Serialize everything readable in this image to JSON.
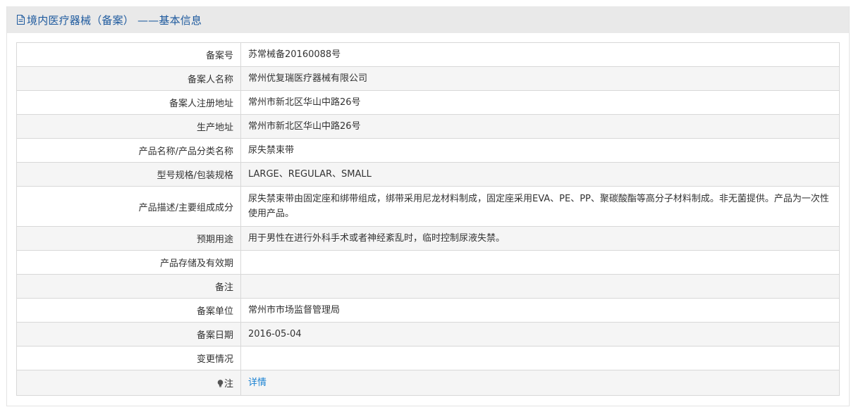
{
  "header": {
    "title": "境内医疗器械（备案） ——基本信息"
  },
  "rows": [
    {
      "label": "备案号",
      "value": "苏常械备20160088号"
    },
    {
      "label": "备案人名称",
      "value": "常州优复瑞医疗器械有限公司"
    },
    {
      "label": "备案人注册地址",
      "value": "常州市新北区华山中路26号"
    },
    {
      "label": "生产地址",
      "value": "常州市新北区华山中路26号"
    },
    {
      "label": "产品名称/产品分类名称",
      "value": "尿失禁束带"
    },
    {
      "label": "型号规格/包装规格",
      "value": "LARGE、REGULAR、SMALL"
    },
    {
      "label": "产品描述/主要组成成分",
      "value": "尿失禁束带由固定座和绑带组成，绑带采用尼龙材料制成，固定座采用EVA、PE、PP、聚碳酸酯等高分子材料制成。非无菌提供。产品为一次性使用产品。"
    },
    {
      "label": "预期用途",
      "value": "用于男性在进行外科手术或者神经紊乱时，临时控制尿液失禁。"
    },
    {
      "label": "产品存储及有效期",
      "value": ""
    },
    {
      "label": "备注",
      "value": ""
    },
    {
      "label": "备案单位",
      "value": "常州市市场监督管理局"
    },
    {
      "label": "备案日期",
      "value": "2016-05-04"
    },
    {
      "label": "变更情况",
      "value": ""
    }
  ],
  "note": {
    "label": "注",
    "link_text": "详情",
    "icon": "lightbulb-icon"
  },
  "colors": {
    "title": "#1e5a9e",
    "link": "#1a82d2",
    "header_bg": "#e9e9e9",
    "stripe_bg": "#f5f5f5",
    "border": "#d8d8d8"
  }
}
